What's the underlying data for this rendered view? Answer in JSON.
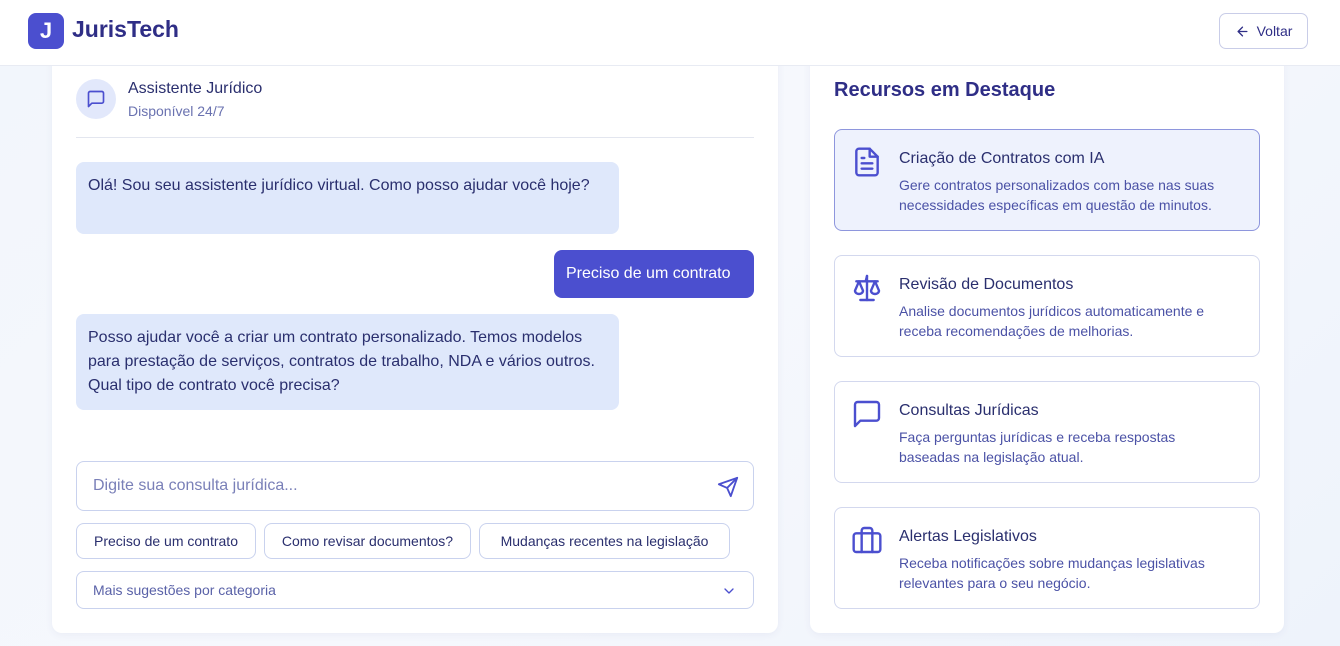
{
  "header": {
    "logo_letter": "J",
    "brand": "JurisTech",
    "back_label": "Voltar"
  },
  "chat": {
    "assistant_name": "Assistente Jurídico",
    "assistant_status": "Disponível 24/7",
    "messages": [
      {
        "role": "bot",
        "text": "Olá! Sou seu assistente jurídico virtual. Como posso ajudar você hoje?"
      },
      {
        "role": "user",
        "text": "Preciso de um contrato"
      },
      {
        "role": "bot",
        "text": "Posso ajudar você a criar um contrato personalizado. Temos modelos para prestação de serviços, contratos de trabalho, NDA e vários outros. Qual tipo de contrato você precisa?"
      }
    ],
    "input_placeholder": "Digite sua consulta jurídica...",
    "input_value": "",
    "suggestions": [
      "Preciso de um contrato",
      "Como revisar documentos?",
      "Mudanças recentes na legislação"
    ],
    "more_suggestions": "Mais sugestões por categoria"
  },
  "sidebar": {
    "title": "Recursos em Destaque",
    "features": [
      {
        "icon": "document-icon",
        "title": "Criação de Contratos com IA",
        "desc": "Gere contratos personalizados com base nas suas necessidades específicas em questão de minutos."
      },
      {
        "icon": "scale-icon",
        "title": "Revisão de Documentos",
        "desc": "Analise documentos jurídicos automaticamente e receba recomendações de melhorias."
      },
      {
        "icon": "chat-icon",
        "title": "Consultas Jurídicas",
        "desc": "Faça perguntas jurídicas e receba respostas baseadas na legislação atual."
      },
      {
        "icon": "briefcase-icon",
        "title": "Alertas Legislativos",
        "desc": "Receba notificações sobre mudanças legislativas relevantes para o seu negócio."
      }
    ]
  },
  "colors": {
    "accent": "#4b4fcf",
    "bot_bubble": "#dfe8fb",
    "text": "#2a2f6e"
  }
}
